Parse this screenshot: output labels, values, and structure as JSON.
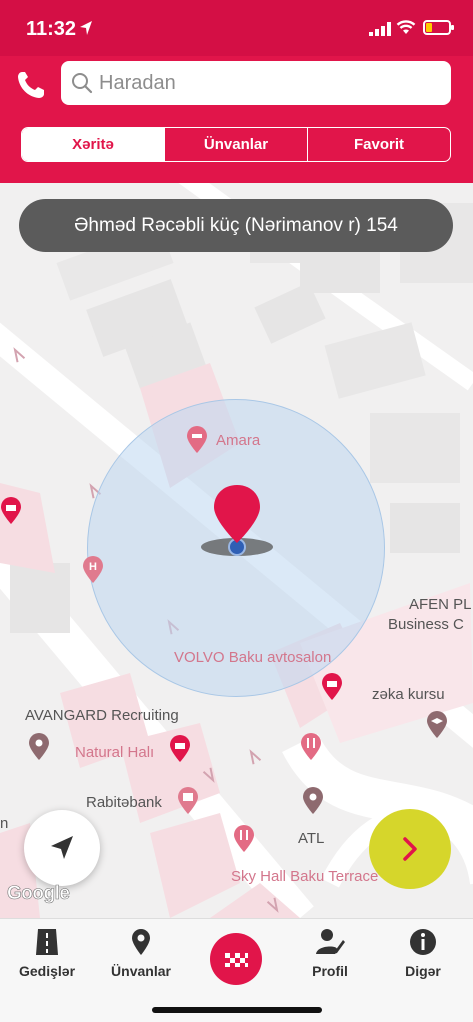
{
  "status_bar": {
    "time": "11:32"
  },
  "search": {
    "placeholder": "Haradan",
    "value": ""
  },
  "segments": [
    {
      "label": "Xəritə",
      "active": true
    },
    {
      "label": "Ünvanlar",
      "active": false
    },
    {
      "label": "Favorit",
      "active": false
    }
  ],
  "map": {
    "address": "Əhməd Rəcəbli küç (Nərimanov r) 154",
    "labels": {
      "amara": "Amara",
      "afen_1": "AFEN PL",
      "afen_2": "Business C",
      "volvo": "VOLVO Baku avtosalon",
      "zeka": "zəka kursu",
      "avangard": "AVANGARD Recruiting",
      "natural": "Natural Halı",
      "rabite": "Rabitəbank",
      "atl": "ATL",
      "skyhall": "Sky Hall Baku Terrace",
      "edge_n": "n"
    },
    "attribution": "Google"
  },
  "tabs": [
    {
      "label": "Gedişlər"
    },
    {
      "label": "Ünvanlar"
    },
    {
      "label": ""
    },
    {
      "label": "Profil"
    },
    {
      "label": "Digər"
    }
  ],
  "colors": {
    "brand": "#e1154a",
    "next_button": "#d6d62b",
    "map_background": "#f1f0f0",
    "address_pill": "#5b5b5b"
  }
}
